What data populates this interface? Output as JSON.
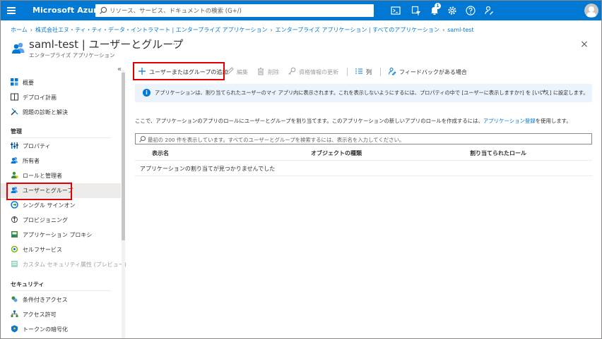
{
  "topbar": {
    "brand": "Microsoft Azure",
    "search_placeholder": "リソース、サービス、ドキュメントの検索 (G+/)",
    "notification_count": "1",
    "accent_color": "#0078d4"
  },
  "breadcrumb": [
    "ホーム",
    "株式会社エヌ・ティ・ティ・データ・イントラマート | エンタープライズ アプリケーション",
    "エンタープライズ アプリケーション | すべてのアプリケーション",
    "saml-test"
  ],
  "header": {
    "title": "saml-test | ユーザーとグループ",
    "subtitle": "エンタープライズ アプリケーション",
    "more": "···",
    "close": "×"
  },
  "sidebar": {
    "collapse": "«",
    "items_top": [
      {
        "label": "概要",
        "icon": "grid-icon"
      },
      {
        "label": "デプロイ計画",
        "icon": "book-icon"
      },
      {
        "label": "問題の診断と解決",
        "icon": "wrench-icon"
      }
    ],
    "section_manage": "管理",
    "items_manage": [
      {
        "label": "プロパティ",
        "icon": "properties-icon"
      },
      {
        "label": "所有者",
        "icon": "owners-icon"
      },
      {
        "label": "ロールと管理者",
        "icon": "roles-icon"
      },
      {
        "label": "ユーザーとグループ",
        "icon": "users-groups-icon",
        "selected": true
      },
      {
        "label": "シングル サインオン",
        "icon": "sso-icon"
      },
      {
        "label": "プロビジョニング",
        "icon": "provisioning-icon"
      },
      {
        "label": "アプリケーション プロキシ",
        "icon": "proxy-icon"
      },
      {
        "label": "セルフサービス",
        "icon": "selfservice-icon"
      },
      {
        "label": "カスタム セキュリティ属性 (プレビュー)",
        "icon": "custom-attr-icon",
        "disabled": true
      }
    ],
    "section_security": "セキュリティ",
    "items_security": [
      {
        "label": "条件付きアクセス",
        "icon": "conditional-access-icon"
      },
      {
        "label": "アクセス許可",
        "icon": "permissions-icon"
      },
      {
        "label": "トークンの暗号化",
        "icon": "token-encryption-icon"
      }
    ]
  },
  "toolbar": {
    "add": "ユーザーまたはグループの追加",
    "edit": "編集",
    "remove": "削除",
    "update_credentials": "資格情報の更新",
    "columns": "列",
    "feedback": "フィードバックがある場合"
  },
  "info": {
    "text": "アプリケーションは、割り当てられたユーザーのマイ アプリ内に表示されます。これを表示しないようにするには、プロパティの中で [ユーザーに表示しますか?] を [いいえ] に設定します。",
    "arrow": "→"
  },
  "description": {
    "text": "ここで、アプリケーションのアプリのロールにユーザーとグループを割り当てます。このアプリケーションの新しいアプリのロールを作成するには、",
    "link": "アプリケーション登録",
    "suffix": "を使用します。"
  },
  "filter": {
    "placeholder": "最初の 200 件を表示しています。すべてのユーザーとグループを検索するには、表示名を入力してください。"
  },
  "table": {
    "columns": [
      "表示名",
      "オブジェクトの種類",
      "割り当てられたロール"
    ],
    "empty_message": "アプリケーションの割り当てが見つかりませんでした"
  }
}
